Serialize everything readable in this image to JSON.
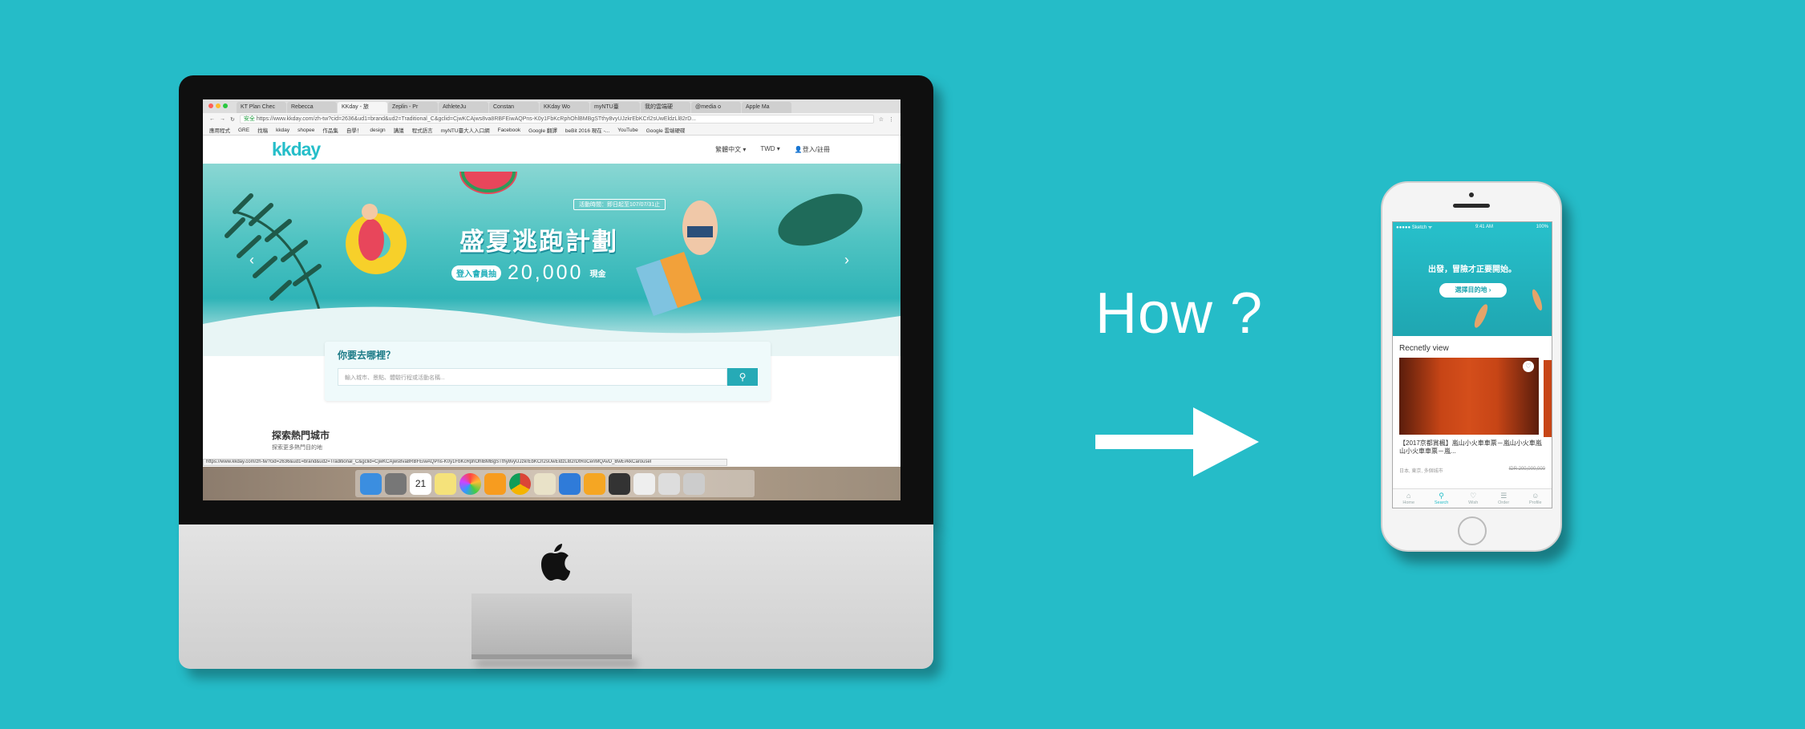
{
  "colors": {
    "background": "#25bcc8",
    "brand": "#26bec9"
  },
  "how_text": "How ?",
  "browser": {
    "tabs": [
      "KT Plan Chec",
      "Rebecca",
      "KKday - 旅",
      "Zeplin - Pr",
      "AthleteJu",
      "Constan",
      "KKday Wo",
      "myNTU臺",
      "我的雲端硬",
      "@media o",
      "Apple Ma"
    ],
    "url_secure": "安全",
    "url": "https://www.kkday.com/zh-tw?cid=2636&ud1=brand&ud2=Traditional_C&gclid=CjwKCAjws8va8RBFEiwAQPns-K0y1FbKcRphOhlBMBgSTthy8vyUJzkrEbKCrl2sUwEldzLl82rD...",
    "bookmarks": [
      "應用程式",
      "GRE",
      "找稿",
      "kkday",
      "shopee",
      "作品集",
      "自學！",
      "design",
      "講議",
      "程式語言",
      "myNTU臺大人入口網",
      "Facebook",
      "Google 翻譯",
      "beBit 2016 現在 -...",
      "YouTube",
      "Google 雲端硬碟"
    ]
  },
  "site": {
    "logo": "kkday",
    "nav": {
      "language": "繁體中文 ▾",
      "currency": "TWD ▾",
      "login": "登入/註冊"
    },
    "hero": {
      "date": "活動時間：即日起至107/07/31止",
      "title": "盛夏逃跑計劃",
      "pill": "登入會員抽",
      "amount": "20,000",
      "unit": "現金"
    },
    "search": {
      "title": "你要去哪裡？",
      "placeholder": "輸入城市、景點、體驗行程或活動名稱..."
    },
    "section": {
      "title": "探索熱門城市",
      "subtitle": "探索更多熱門目的地"
    },
    "status_url": "https://www.kkday.com/zh-tw?cid=2636&ud1=brand&ud2=Traditional_C&gclid=CjwKCAjws8va8RBFEiwAQPns-K0y1FbKcRphOhlBMBgSTthy8vyUJzkrEbKCrl2sUwEldzLl82rDtRoCenMQAvD_BwE#kkCarousel"
  },
  "dock": {
    "calendar_day": "21"
  },
  "phone": {
    "status": {
      "carrier": "●●●●● Sketch ᯤ",
      "time": "9:41 AM",
      "battery": "100%"
    },
    "hero_text": "出發，冒險才正要開始。",
    "hero_button": "選擇目的地 ›",
    "recent_label": "Recnetly view",
    "card_title": "【2017京都賞楓】嵐山小火車車票－嵐山小火車嵐山小火車車票－嵐...",
    "card_location": "日本, 東京, 多個城市",
    "card_price": "IDR 200,000,000",
    "tabs": [
      "Home",
      "Search",
      "Wish",
      "Order",
      "Profile"
    ]
  }
}
